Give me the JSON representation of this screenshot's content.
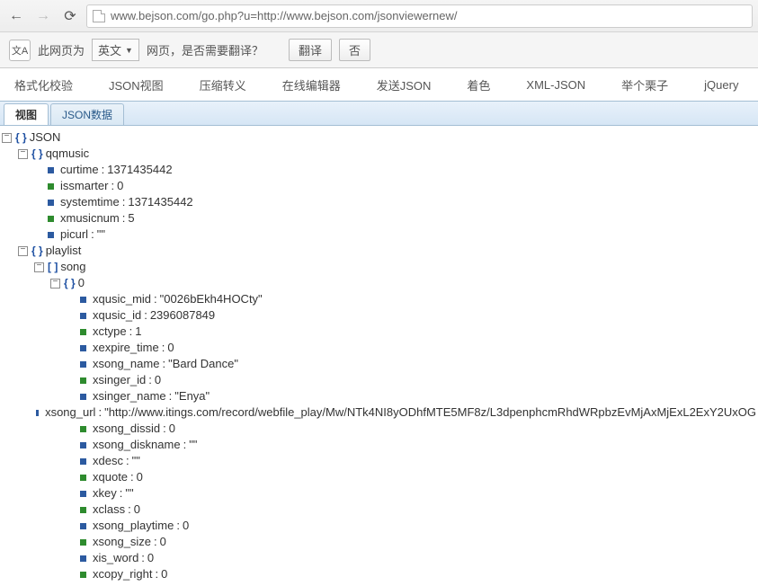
{
  "browser": {
    "url": "www.bejson.com/go.php?u=http://www.bejson.com/jsonviewernew/"
  },
  "translate": {
    "prefix": "此网页为",
    "lang": "英文",
    "suffix": "网页，是否需要翻译？",
    "translate_btn": "翻译",
    "no_btn": "否"
  },
  "menu": {
    "items": [
      "格式化校验",
      "JSON视图",
      "压缩转义",
      "在线编辑器",
      "发送JSON",
      "着色",
      "XML-JSON",
      "举个栗子",
      "jQuery"
    ]
  },
  "tabs": {
    "view": "视图",
    "data": "JSON数据"
  },
  "tree": {
    "root": "JSON",
    "qqmusic": "qqmusic",
    "qqmusic_props": [
      {
        "c": "blue",
        "k": "curtime",
        "v": "1371435442"
      },
      {
        "c": "green",
        "k": "issmarter",
        "v": "0"
      },
      {
        "c": "blue",
        "k": "systemtime",
        "v": "1371435442"
      },
      {
        "c": "green",
        "k": "xmusicnum",
        "v": "5"
      },
      {
        "c": "blue",
        "k": "picurl",
        "v": "\"\""
      }
    ],
    "playlist": "playlist",
    "song": "song",
    "index0": "0",
    "song0_props": [
      {
        "c": "blue",
        "k": "xqusic_mid",
        "v": "\"0026bEkh4HOCty\""
      },
      {
        "c": "blue",
        "k": "xqusic_id",
        "v": "2396087849"
      },
      {
        "c": "green",
        "k": "xctype",
        "v": "1"
      },
      {
        "c": "blue",
        "k": "xexpire_time",
        "v": "0"
      },
      {
        "c": "blue",
        "k": "xsong_name",
        "v": "\"Bard Dance\""
      },
      {
        "c": "green",
        "k": "xsinger_id",
        "v": "0"
      },
      {
        "c": "blue",
        "k": "xsinger_name",
        "v": "\"Enya\""
      },
      {
        "c": "blue",
        "k": "xsong_url",
        "v": "\"http://www.itings.com/record/webfile_play/Mw/NTk4NI8yODhfMTE5MF8z/L3dpenphcmRhdWRpbzEvMjAxMjExL2ExY2UxOG"
      },
      {
        "c": "green",
        "k": "xsong_dissid",
        "v": "0"
      },
      {
        "c": "blue",
        "k": "xsong_diskname",
        "v": "\"\""
      },
      {
        "c": "blue",
        "k": "xdesc",
        "v": "\"\""
      },
      {
        "c": "green",
        "k": "xquote",
        "v": "0"
      },
      {
        "c": "blue",
        "k": "xkey",
        "v": "\"\""
      },
      {
        "c": "green",
        "k": "xclass",
        "v": "0"
      },
      {
        "c": "blue",
        "k": "xsong_playtime",
        "v": "0"
      },
      {
        "c": "green",
        "k": "xsong_size",
        "v": "0"
      },
      {
        "c": "blue",
        "k": "xis_word",
        "v": "0"
      },
      {
        "c": "green",
        "k": "xcopy_right",
        "v": "0"
      }
    ]
  }
}
